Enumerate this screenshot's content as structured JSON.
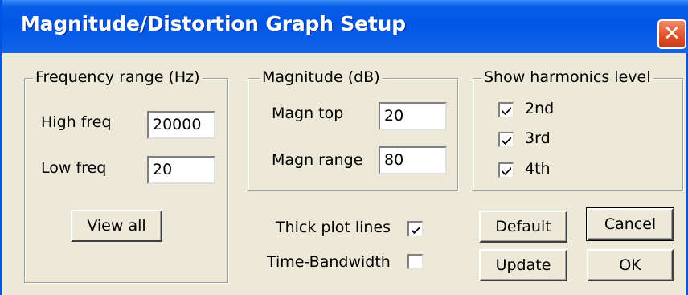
{
  "window": {
    "title": "Magnitude/Distortion Graph Setup",
    "close_icon": "close-icon"
  },
  "frequency": {
    "group_label": "Frequency range (Hz)",
    "high_label": "High freq",
    "high_value": "20000",
    "low_label": "Low freq",
    "low_value": "20",
    "view_all_label": "View all"
  },
  "magnitude": {
    "group_label": "Magnitude (dB)",
    "top_label": "Magn top",
    "top_value": "20",
    "range_label": "Magn range",
    "range_value": "80"
  },
  "harmonics": {
    "group_label": "Show harmonics level",
    "items": [
      {
        "label": "2nd",
        "checked": true
      },
      {
        "label": "3rd",
        "checked": true
      },
      {
        "label": "4th",
        "checked": true
      }
    ]
  },
  "options": {
    "thick_label": "Thick plot lines",
    "thick_checked": true,
    "tb_label": "Time-Bandwidth",
    "tb_checked": false
  },
  "buttons": {
    "default_label": "Default",
    "cancel_label": "Cancel",
    "update_label": "Update",
    "ok_label": "OK"
  }
}
